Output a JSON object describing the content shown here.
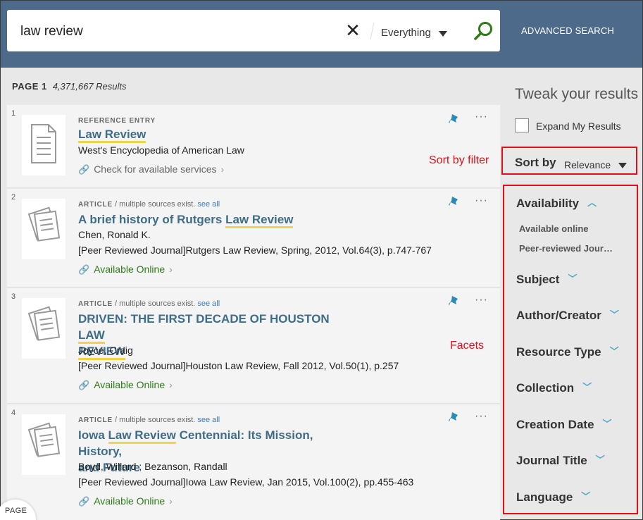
{
  "search": {
    "query": "law review",
    "clear": "✕",
    "scope": "Everything",
    "advanced": "ADVANCED SEARCH"
  },
  "results_info": {
    "page": "PAGE 1",
    "count": "4,371,667 Results"
  },
  "results": [
    {
      "num": "1",
      "type": "REFERENCE ENTRY",
      "type_extra": "",
      "see_all": "",
      "title_pre": "",
      "title_hl": "Law Review",
      "title_post": "",
      "title_line2_hl": "",
      "meta1": "West's Encyclopedia of American Law",
      "meta2": "",
      "availability": "Check for available services"
    },
    {
      "num": "2",
      "type": "ARTICLE",
      "type_extra": " / multiple sources exist.",
      "see_all": "see all",
      "title_pre": "A brief history of Rutgers ",
      "title_hl": "Law Review",
      "title_post": "",
      "meta1": "Chen, Ronald K.",
      "meta2": "[Peer Reviewed Journal]Rutgers Law Review, Spring, 2012, Vol.64(3), p.747-767",
      "availability": "Available Online"
    },
    {
      "num": "3",
      "type": "ARTICLE",
      "type_extra": " / multiple sources exist.",
      "see_all": "see all",
      "title_pre": "DRIVEN: THE FIRST DECADE OF HOUSTON ",
      "title_hl": "LAW",
      "title_line2_hl": "REVIEW",
      "meta1": "Joyce, Craig",
      "meta2": "[Peer Reviewed Journal]Houston Law Review, Fall 2012, Vol.50(1), p.257",
      "availability": "Available Online"
    },
    {
      "num": "4",
      "type": "ARTICLE",
      "type_extra": " / multiple sources exist.",
      "see_all": "see all",
      "title_pre": "Iowa ",
      "title_hl": "Law Review",
      "title_post": " Centennial: Its Mission, History,",
      "title_line2": "and Future",
      "meta1": "Boyd, Willard ; Bezanson, Randall",
      "meta2": "[Peer Reviewed Journal]Iowa Law Review, Jan 2015, Vol.100(2), pp.455-463",
      "availability": "Available Online"
    }
  ],
  "sidebar": {
    "tweak": "Tweak your results",
    "expand": "Expand My Results",
    "sort_label": "Sort by",
    "sort_value": "Relevance",
    "facets": [
      {
        "label": "Availability",
        "expanded": true,
        "items": [
          "Available online",
          "Peer-reviewed Jour…"
        ]
      },
      {
        "label": "Subject"
      },
      {
        "label": "Author/Creator"
      },
      {
        "label": "Resource Type"
      },
      {
        "label": "Collection"
      },
      {
        "label": "Creation Date"
      },
      {
        "label": "Journal Title"
      },
      {
        "label": "Language"
      }
    ]
  },
  "annotations": {
    "sort": "Sort by filter",
    "facets": "Facets"
  },
  "page_bubble": "PAGE",
  "colors": {
    "header": "#4e6a8b",
    "highlight": "#f2d34a",
    "title": "#3f6d87",
    "available": "#2e7a1b",
    "annotation": "#e0101a"
  }
}
